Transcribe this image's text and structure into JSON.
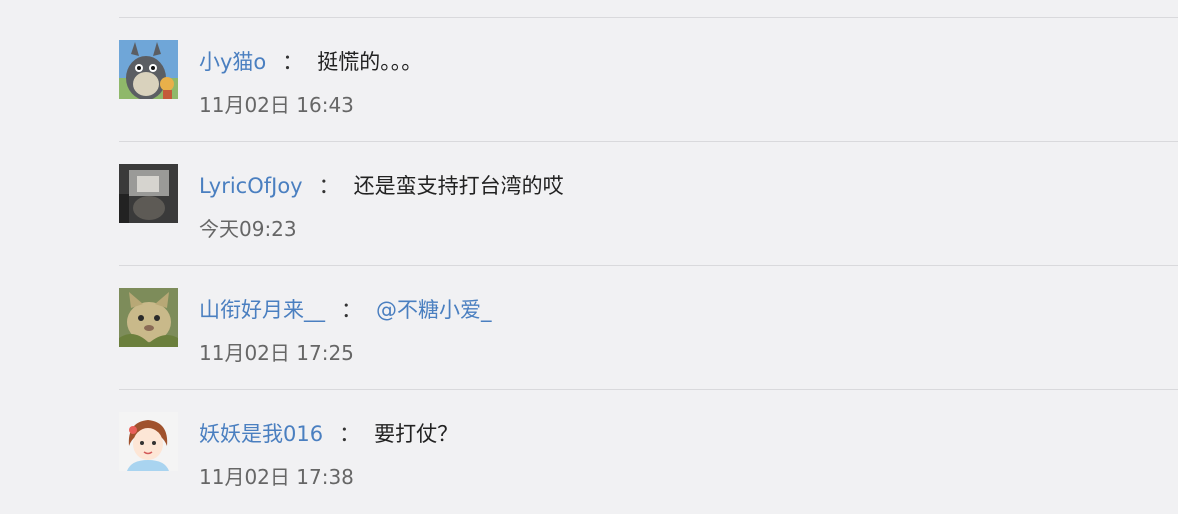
{
  "comments": [
    {
      "avatar_icon": "totoro-avatar-icon",
      "username": "小y猫o",
      "colon": "：",
      "text": "挺慌的。。。",
      "mention": "",
      "time": "11月02日 16:43"
    },
    {
      "avatar_icon": "blurred-photo-avatar-icon",
      "username": "LyricOfJoy",
      "colon": "：",
      "text": "还是蛮支持打台湾的哎",
      "mention": "",
      "time": "今天09:23"
    },
    {
      "avatar_icon": "cat-avatar-icon",
      "username": "山衔好月来__",
      "colon": "：",
      "text": "",
      "mention": "@不糖小爱_",
      "time": "11月02日 17:25"
    },
    {
      "avatar_icon": "cartoon-girl-avatar-icon",
      "username": "妖妖是我016",
      "colon": "：",
      "text": "要打仗？",
      "mention": "",
      "time": "11月02日 17:38"
    }
  ],
  "colors": {
    "background": "#f1f1f3",
    "username": "#4a7fc0",
    "divider": "#d9d9dc",
    "time": "#666666"
  }
}
